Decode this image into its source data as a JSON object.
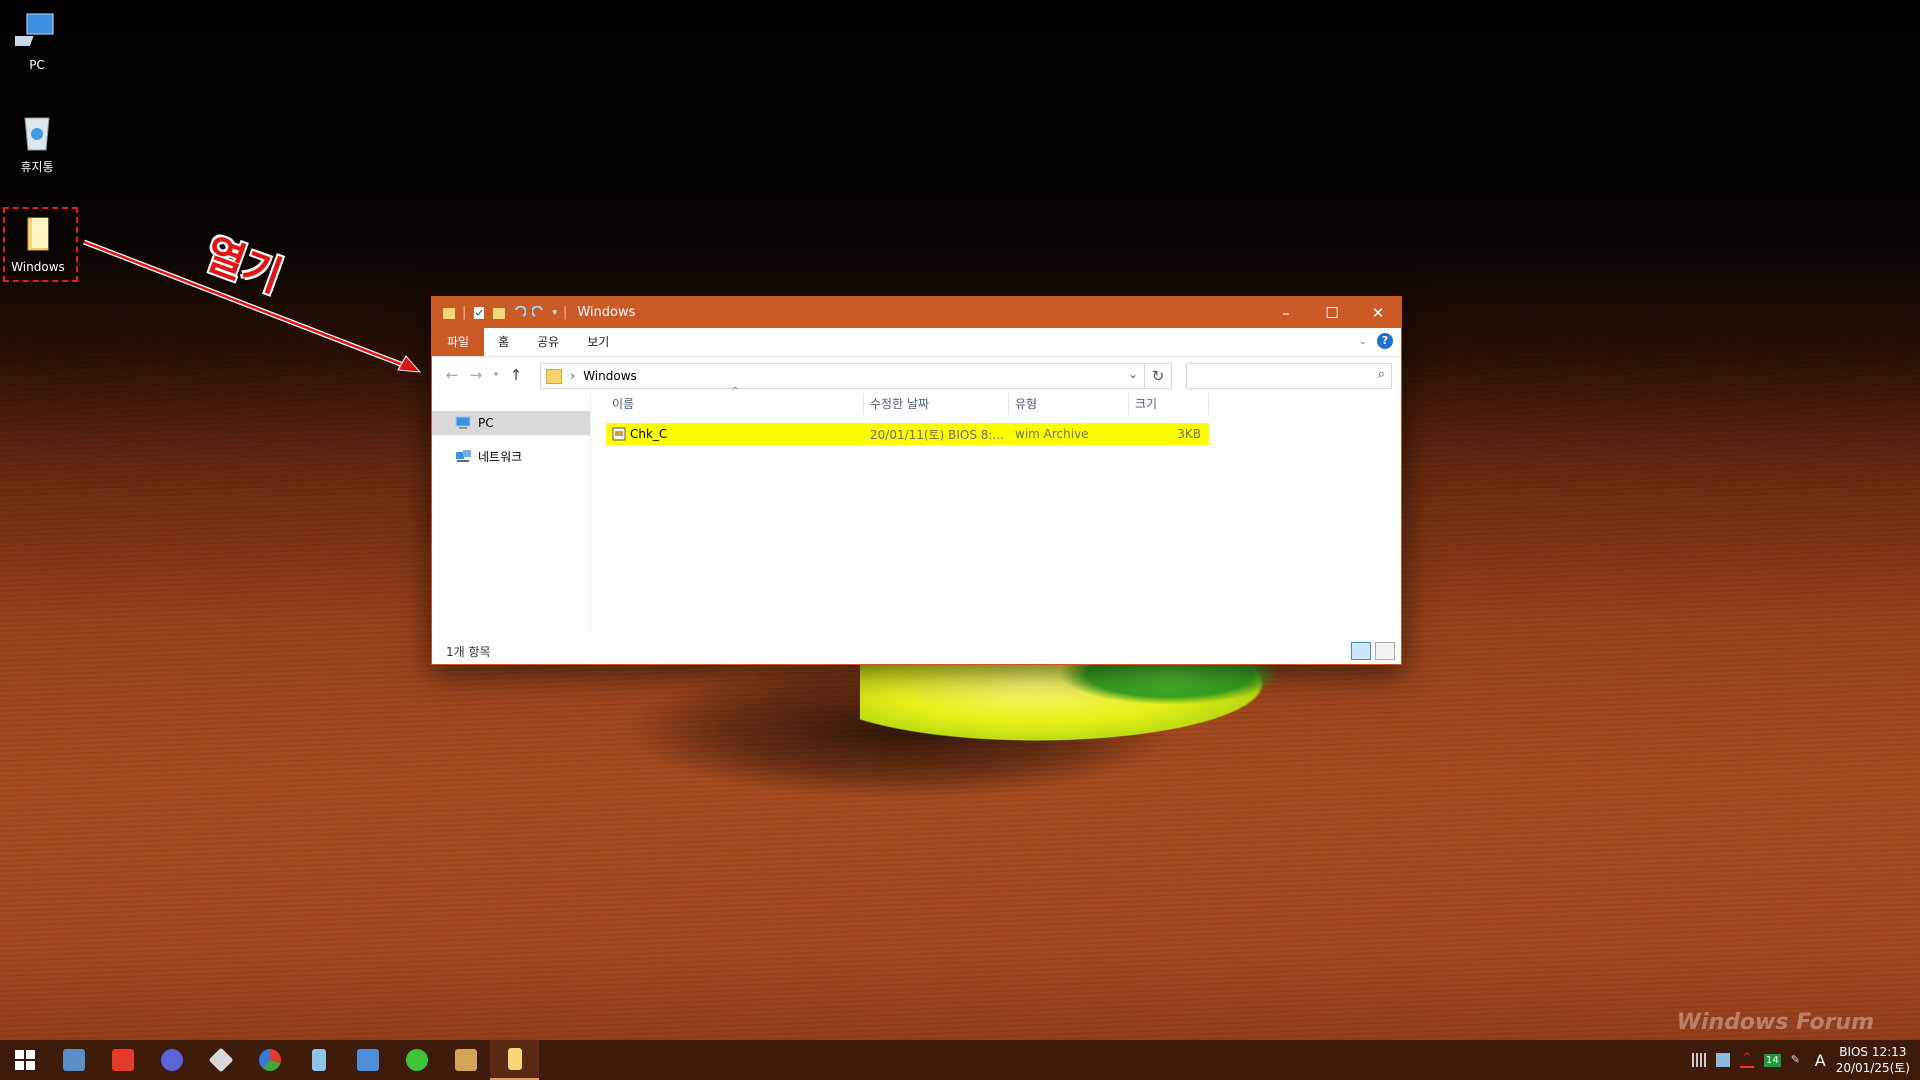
{
  "desktop": {
    "icons": [
      {
        "label": "PC",
        "icon": "pc-icon"
      },
      {
        "label": "휴지통",
        "icon": "recycle-bin-icon"
      },
      {
        "label": "Windows",
        "icon": "folder-icon"
      }
    ],
    "annotation": "열기"
  },
  "window": {
    "title": "Windows",
    "ribbon_tabs": [
      "파일",
      "홈",
      "공유",
      "보기"
    ],
    "address": {
      "path": "Windows"
    },
    "search": {
      "placeholder": ""
    },
    "nav_pane": [
      {
        "label": "PC",
        "icon": "pc-icon",
        "selected": true
      },
      {
        "label": "네트워크",
        "icon": "network-icon",
        "selected": false
      }
    ],
    "columns": [
      "이름",
      "수정한 날짜",
      "유형",
      "크기"
    ],
    "files": [
      {
        "name": "Chk_C",
        "modified": "20/01/11(토) BIOS 8:...",
        "type": "wim Archive",
        "size": "3KB",
        "highlight": "#ffff00"
      }
    ],
    "status": "1개 항목"
  },
  "watermark": "Windows Forum",
  "taskbar": {
    "active_index": 10,
    "tray": {
      "ime": "A",
      "badge": "14",
      "clock_line1": "BIOS  12:13",
      "clock_line2": "20/01/25(토)"
    }
  },
  "colors": {
    "accent": "#cc5a27",
    "highlight": "#ffff00",
    "annotation": "#e31414"
  }
}
